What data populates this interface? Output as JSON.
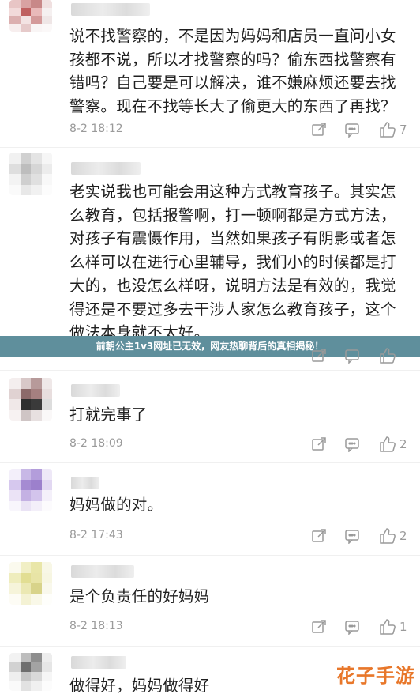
{
  "comments": [
    {
      "text": "说不找警察的，不是因为妈妈和店员一直问小女孩都不说，所以才找警察的吗？偷东西找警察有错吗？自己要是可以解决，谁不嫌麻烦还要去找警察。现在不找等长大了偷更大的东西了再找？",
      "date": "8-2 18:12",
      "likes": "7"
    },
    {
      "text": "老实说我也可能会用这种方式教育孩子。其实怎么教育，包括报警啊，打一顿啊都是方式方法，对孩子有震慑作用，当然如果孩子有阴影或者怎么样可以在进行心里辅导，我们小的时候都是打大的，也没怎么样呀，说明方法是有效的，我觉得还是不要过多去干涉人家怎么教育孩子，这个做法本身就不太好。"
    },
    {
      "text": "打就完事了",
      "date": "8-2 18:09",
      "likes": "2"
    },
    {
      "text": "妈妈做的对。",
      "date": "8-2 17:43",
      "likes": "2"
    },
    {
      "text": "是个负责任的好妈妈",
      "date": "8-2 18:13",
      "likes": "1"
    },
    {
      "text": "做得好，妈妈做得好"
    }
  ],
  "banner": "前朝公主1v3网址已无效，网友热聊背后的真相揭秘！",
  "watermark": "花子手游",
  "colors": {
    "meta": "#9a9a9a",
    "banner_bg": "#5f8f9c",
    "watermark": "#e8772a"
  }
}
